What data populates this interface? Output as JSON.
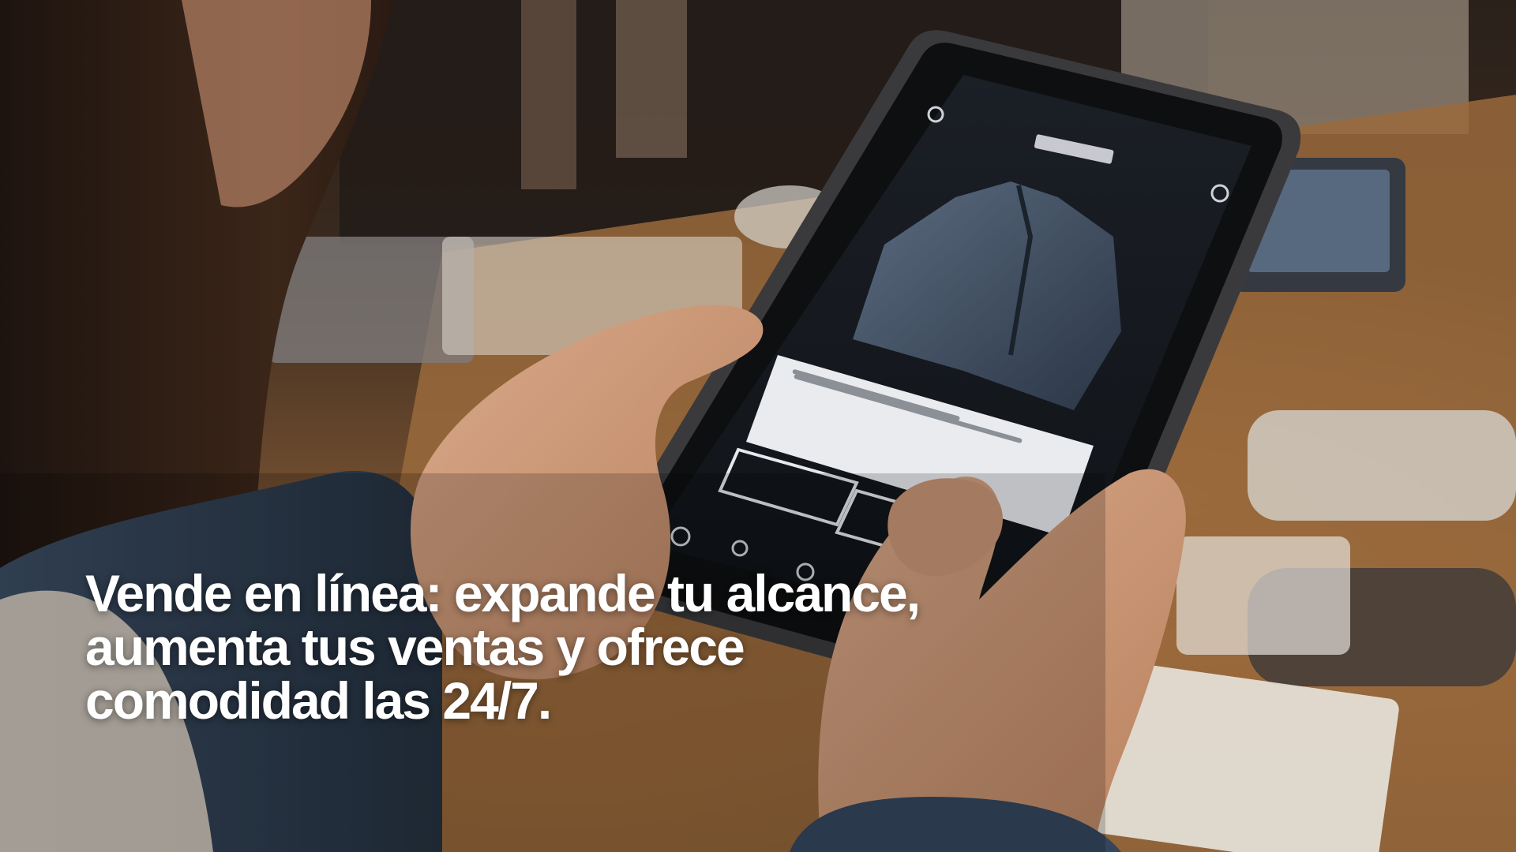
{
  "caption": {
    "text": "Vende en línea: expande tu alcance, aumenta tus ventas y ofrece comodidad las 24/7."
  },
  "photo": {
    "subject": "person-holding-tablet-with-clothing-store-app",
    "tablet_screen_colors": {
      "background": "#15181d",
      "jacket": "#3c4a5c",
      "text_panel": "#e9ebee"
    },
    "table_color": "#9a6a3c"
  }
}
